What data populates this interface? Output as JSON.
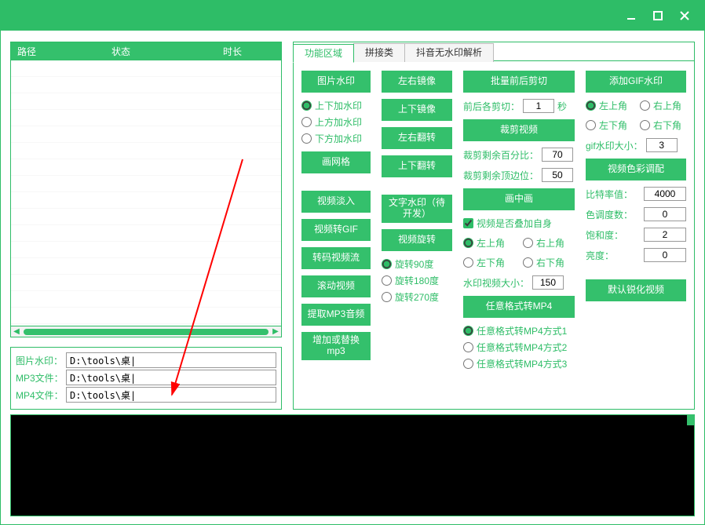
{
  "window": {
    "min": "—",
    "max": "□",
    "close": "×"
  },
  "list": {
    "col1": "路径",
    "col2": "状态",
    "col3": "时长"
  },
  "paths": {
    "l1": "图片水印：",
    "v1": "D:\\tools\\桌|",
    "l2": "MP3文件：",
    "v2": "D:\\tools\\桌|",
    "l3": "MP4文件：",
    "v3": "D:\\tools\\桌|"
  },
  "tabs": {
    "t1": "功能区域",
    "t2": "拼接类",
    "t3": "抖音无水印解析"
  },
  "col1": {
    "b1": "图片水印",
    "r1": "上下加水印",
    "r2": "上方加水印",
    "r3": "下方加水印",
    "b2": "画网格",
    "b3": "视频淡入",
    "b4": "视频转GIF",
    "b5": "转码视频流",
    "b6": "滚动视频",
    "b7": "提取MP3音频",
    "b8": "增加或替换mp3"
  },
  "col2": {
    "b1": "左右镜像",
    "b2": "上下镜像",
    "b3": "左右翻转",
    "b4": "上下翻转",
    "b5": "文字水印（待开发）",
    "b6": "视频旋转",
    "r1": "旋转90度",
    "r2": "旋转180度",
    "r3": "旋转270度"
  },
  "col3": {
    "b1": "批量前后剪切",
    "kv1": "前后各剪切：",
    "kv1v": "1",
    "kv1u": "秒",
    "b2": "裁剪视频",
    "kv2": "裁剪剩余百分比：",
    "kv2v": "70",
    "kv3": "裁剪剩余顶边位：",
    "kv3v": "50",
    "b3": "画中画",
    "c1": "视频是否叠加自身",
    "r1": "左上角",
    "r2": "右上角",
    "r3": "左下角",
    "r4": "右下角",
    "kv4": "水印视频大小：",
    "kv4v": "150",
    "b4": "任意格式转MP4",
    "rA": "任意格式转MP4方式1",
    "rB": "任意格式转MP4方式2",
    "rC": "任意格式转MP4方式3"
  },
  "col4": {
    "b1": "添加GIF水印",
    "r1": "左上角",
    "r2": "右上角",
    "r3": "左下角",
    "r4": "右下角",
    "kv1": "gif水印大小：",
    "kv1v": "3",
    "b2": "视频色彩调配",
    "k2": "比特率值：",
    "v2": "4000",
    "k3": "色调度数：",
    "v3": "0",
    "k4": "饱和度：",
    "v4": "2",
    "k5": "亮度：",
    "v5": "0",
    "b3": "默认锐化视频"
  }
}
